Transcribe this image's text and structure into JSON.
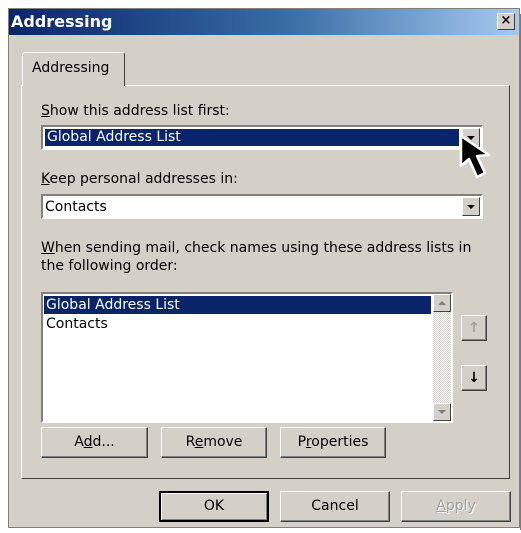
{
  "window": {
    "title": "Addressing",
    "close_glyph": "×"
  },
  "tab": {
    "label": "Addressing"
  },
  "show_first": {
    "label_ul": "S",
    "label_rest": "how this address list first:",
    "value": "Global Address List"
  },
  "keep_personal": {
    "label_ul": "K",
    "label_rest": "eep personal addresses in:",
    "value": "Contacts"
  },
  "check_names": {
    "label_ul": "W",
    "label_line1_rest": "hen sending mail, check names using these address lists in",
    "label_line2": "the following order:",
    "items": [
      "Global Address List",
      "Contacts"
    ],
    "selected_index": 0
  },
  "move_up": {
    "glyph": "↑",
    "icon": "arrow-up-icon"
  },
  "move_down": {
    "glyph": "↓",
    "icon": "arrow-down-icon"
  },
  "buttons": {
    "add": {
      "pre": "A",
      "ul": "d",
      "post": "d..."
    },
    "remove": {
      "pre": "R",
      "ul": "e",
      "post": "move"
    },
    "properties": {
      "pre": "P",
      "ul": "r",
      "post": "operties"
    },
    "ok": "OK",
    "cancel": "Cancel",
    "apply": {
      "ul": "A",
      "post": "pply"
    }
  },
  "colors": {
    "selection": "#0a246a",
    "face": "#d4d0c8",
    "title_start": "#0a246a",
    "title_end": "#a6caf0"
  }
}
